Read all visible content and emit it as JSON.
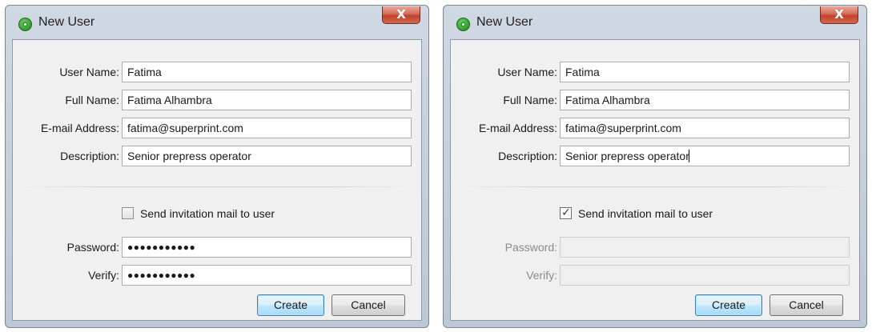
{
  "dialogs": [
    {
      "title": "New User",
      "close_label": "X",
      "fields": {
        "user_name": {
          "label": "User Name:",
          "value": "Fatima"
        },
        "full_name": {
          "label": "Full Name:",
          "value": "Fatima Alhambra"
        },
        "email": {
          "label": "E-mail Address:",
          "value": "fatima@superprint.com"
        },
        "description": {
          "label": "Description:",
          "value": "Senior prepress operator"
        }
      },
      "send_invitation": {
        "label": "Send invitation mail to user",
        "checked": false
      },
      "password": {
        "label": "Password:",
        "value": "●●●●●●●●●●●",
        "enabled": true
      },
      "verify": {
        "label": "Verify:",
        "value": "●●●●●●●●●●●",
        "enabled": true
      },
      "buttons": {
        "create": "Create",
        "cancel": "Cancel"
      }
    },
    {
      "title": "New User",
      "close_label": "X",
      "fields": {
        "user_name": {
          "label": "User Name:",
          "value": "Fatima"
        },
        "full_name": {
          "label": "Full Name:",
          "value": "Fatima Alhambra"
        },
        "email": {
          "label": "E-mail Address:",
          "value": "fatima@superprint.com"
        },
        "description": {
          "label": "Description:",
          "value": "Senior prepress operator"
        }
      },
      "send_invitation": {
        "label": "Send invitation mail to user",
        "checked": true,
        "mark": "✓"
      },
      "password": {
        "label": "Password:",
        "value": "",
        "enabled": false
      },
      "verify": {
        "label": "Verify:",
        "value": "",
        "enabled": false
      },
      "buttons": {
        "create": "Create",
        "cancel": "Cancel"
      }
    }
  ],
  "colors": {
    "window_frame": "#bcc8d6",
    "panel_bg": "#f0f0f0",
    "close_button": "#c2412a",
    "default_button_border": "#3c7fb1",
    "app_icon": "#2f9a2c"
  },
  "icons": {
    "app": "app-icon",
    "close": "close-icon",
    "check": "checkmark-icon"
  }
}
